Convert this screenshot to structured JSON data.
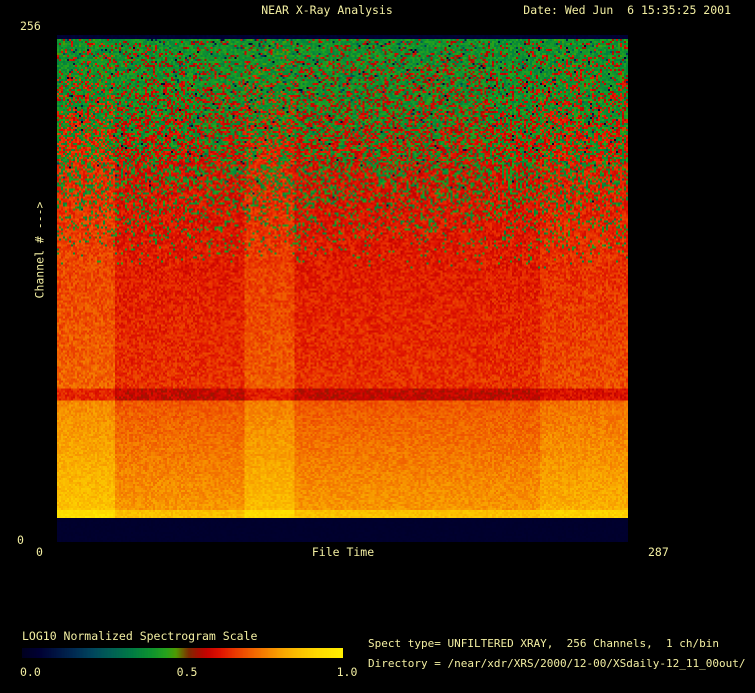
{
  "window": {
    "title": "NEAR X-Ray Analysis",
    "date": "Date: Wed Jun  6 15:35:25 2001"
  },
  "colors": {
    "background": "#000000",
    "text": "#f3efa2"
  },
  "axes": {
    "y_max_label": "256",
    "y_min_label": "0",
    "y_title": "Channel # --->",
    "x_min_label": "0",
    "x_title": "File Time",
    "x_max_label": "287"
  },
  "colorbar": {
    "title": "LOG10 Normalized Spectrogram Scale",
    "tick_labels": [
      "0.0",
      "0.5",
      "1.0"
    ]
  },
  "info": {
    "spect_type_line": "Spect type= UNFILTERED XRAY,  256 Channels,  1 ch/bin",
    "directory_line": "Directory = /near/xdr/XRS/2000/12-00/XSdaily-12_11_00out/"
  },
  "chart_data": {
    "type": "heatmap",
    "title": "NEAR X-Ray Analysis",
    "xlabel": "File Time",
    "ylabel": "Channel # --->",
    "x_range": [
      0,
      287
    ],
    "y_range": [
      0,
      256
    ],
    "value_scale": "LOG10 normalized spectrogram scale, 0.0 to 1.0",
    "legend_position": "bottom-left colorbar",
    "grid": {
      "cols": 286,
      "rows": 254
    },
    "noise_seed": 42,
    "colormap_stops": [
      [
        0.0,
        "#000020"
      ],
      [
        0.05,
        "#000033"
      ],
      [
        0.1,
        "#001240"
      ],
      [
        0.16,
        "#002a52"
      ],
      [
        0.22,
        "#00465c"
      ],
      [
        0.28,
        "#006154"
      ],
      [
        0.34,
        "#007a44"
      ],
      [
        0.4,
        "#0d9230"
      ],
      [
        0.45,
        "#27a31c"
      ],
      [
        0.48,
        "#4f9a02"
      ],
      [
        0.5,
        "#6b6000"
      ],
      [
        0.52,
        "#7e2a00"
      ],
      [
        0.55,
        "#a80e00"
      ],
      [
        0.58,
        "#c80300"
      ],
      [
        0.62,
        "#e01400"
      ],
      [
        0.66,
        "#e93500"
      ],
      [
        0.7,
        "#ef5500"
      ],
      [
        0.75,
        "#f47a00"
      ],
      [
        0.8,
        "#f89e00"
      ],
      [
        0.86,
        "#fbbf00"
      ],
      [
        0.92,
        "#fed900"
      ],
      [
        1.0,
        "#ffef00"
      ]
    ],
    "vertical_profile": [
      {
        "f0": 0.0,
        "f1": 0.006,
        "kind": "flat",
        "v": 0.05,
        "noise": 0.01,
        "note": "thin dark navy line at top edge (channel 256)"
      },
      {
        "f0": 0.006,
        "f1": 0.698,
        "kind": "bimodal",
        "green_v": 0.405,
        "green_noise": 0.052,
        "red_v0": 0.575,
        "red_v1": 0.655,
        "red_noise": 0.045,
        "p_red0": 0.12,
        "p_red1": 1.45,
        "dark_p0": 0.05,
        "note": "noisy green speckle at high channels fading into solid red toward low channels"
      },
      {
        "f0": 0.698,
        "f1": 0.72,
        "kind": "flat",
        "v": 0.575,
        "noise": 0.04,
        "note": "darker red horizontal band"
      },
      {
        "f0": 0.72,
        "f1": 0.937,
        "kind": "ramp",
        "v0": 0.7,
        "v1": 0.79,
        "noise": 0.035,
        "note": "orange band brightening downward"
      },
      {
        "f0": 0.937,
        "f1": 0.953,
        "kind": "flat",
        "v": 0.865,
        "noise": 0.03,
        "note": "bright yellow row near channel ~12"
      },
      {
        "f0": 0.953,
        "f1": 1.0,
        "kind": "flat",
        "v": 0.035,
        "noise": 0.006,
        "note": "flat dark navy band at lowest channels"
      }
    ],
    "bright_time_columns": [
      {
        "t_start": 0,
        "t_end": 29,
        "boost": 0.055,
        "note": "bright vertical stripe, file time 0-29"
      },
      {
        "t_start": 94,
        "t_end": 119,
        "boost": 0.045,
        "note": "bright vertical stripe, file time 94-119"
      },
      {
        "t_start": 243,
        "t_end": 287,
        "boost": 0.028,
        "note": "slightly brighter region, file time 243-287"
      }
    ]
  }
}
